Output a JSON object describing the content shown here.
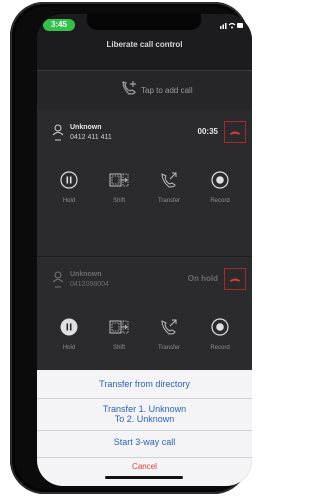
{
  "status_bar": {
    "time": "3:45"
  },
  "header": {
    "title": "Liberate call control"
  },
  "add_call": {
    "label": "Tap to add call"
  },
  "calls": [
    {
      "name": "Unknown",
      "number": "0412 411 411",
      "status": "00:35"
    },
    {
      "name": "Unknown",
      "number": "0412098004",
      "status": "On hold"
    }
  ],
  "controls": [
    {
      "label": "Hold",
      "icon": "pause-icon"
    },
    {
      "label": "Shift",
      "icon": "shift-icon"
    },
    {
      "label": "Transfer",
      "icon": "transfer-icon"
    },
    {
      "label": "Record",
      "icon": "record-icon"
    }
  ],
  "action_sheet": {
    "items": [
      "Transfer from directory",
      "Transfer 1. Unknown",
      "To 2. Unknown",
      "Start 3-way call"
    ],
    "cancel": "Cancel"
  },
  "colors": {
    "accent_green": "#33c04b",
    "hangup_red": "#d83b3b",
    "sheet_text": "#2b63b5",
    "cancel_red": "#e23b2e"
  }
}
